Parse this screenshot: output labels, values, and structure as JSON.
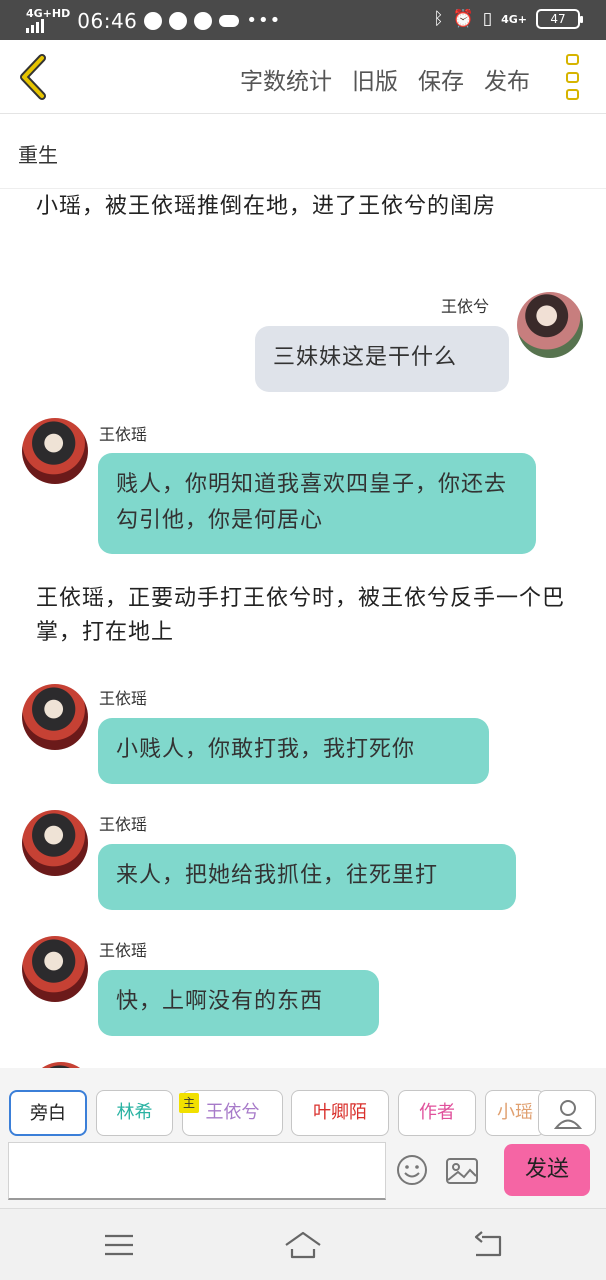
{
  "status_bar": {
    "network": "4G+HD",
    "time": "06:46",
    "network_right": "4G+",
    "battery": "47",
    "icons": [
      "signal-icon",
      "opera-icon",
      "qq-icon",
      "wechat-icon",
      "cloud-icon",
      "more-dots-icon",
      "bluetooth-icon",
      "alarm-icon",
      "vibrate-icon",
      "battery-icon"
    ]
  },
  "toolbar": {
    "back_icon": "chevron-left-icon",
    "actions": [
      "字数统计",
      "旧版",
      "保存",
      "发布"
    ],
    "more_icon": "more-vertical-icon",
    "accent_color": "#d6b400"
  },
  "chapter": {
    "title": "重生"
  },
  "chat": {
    "items": [
      {
        "type": "narration",
        "text": "小瑶，被王依瑶推倒在地，进了王依兮的闺房"
      },
      {
        "type": "message",
        "side": "right",
        "speaker": "王依兮",
        "text": "三妹妹这是干什么"
      },
      {
        "type": "message",
        "side": "left",
        "speaker": "王依瑶",
        "text": "贱人，你明知道我喜欢四皇子，你还去勾引他，你是何居心"
      },
      {
        "type": "narration",
        "text": "王依瑶，正要动手打王依兮时，被王依兮反手一个巴掌，打在地上"
      },
      {
        "type": "message",
        "side": "left",
        "speaker": "王依瑶",
        "text": "小贱人，你敢打我，我打死你"
      },
      {
        "type": "message",
        "side": "left",
        "speaker": "王依瑶",
        "text": "来人，把她给我抓住，往死里打"
      },
      {
        "type": "message",
        "side": "left",
        "speaker": "王依瑶",
        "text": "快，上啊没有的东西"
      }
    ],
    "bubble_colors": {
      "left": "#80d8cc",
      "right": "#dfe3ea"
    }
  },
  "roles": {
    "items": [
      {
        "label": "旁白",
        "color": "#333333",
        "selected": true
      },
      {
        "label": "林希",
        "color": "#2bb3a3",
        "selected": false
      },
      {
        "label": "王依兮",
        "color": "#a77ac9",
        "selected": false,
        "tag": "主"
      },
      {
        "label": "叶卿陌",
        "color": "#d9302c",
        "selected": false
      },
      {
        "label": "作者",
        "color": "#e0509b",
        "selected": false
      },
      {
        "label": "小瑶",
        "color": "#e0a070",
        "selected": false
      }
    ],
    "user_icon": "user-icon"
  },
  "composer": {
    "input_value": "",
    "placeholder": "",
    "emoji_icon": "emoji-icon",
    "image_icon": "image-icon",
    "send_label": "发送",
    "send_color": "#f565a4"
  },
  "system_nav": {
    "icons": [
      "menu-icon",
      "home-icon",
      "back-icon"
    ]
  }
}
